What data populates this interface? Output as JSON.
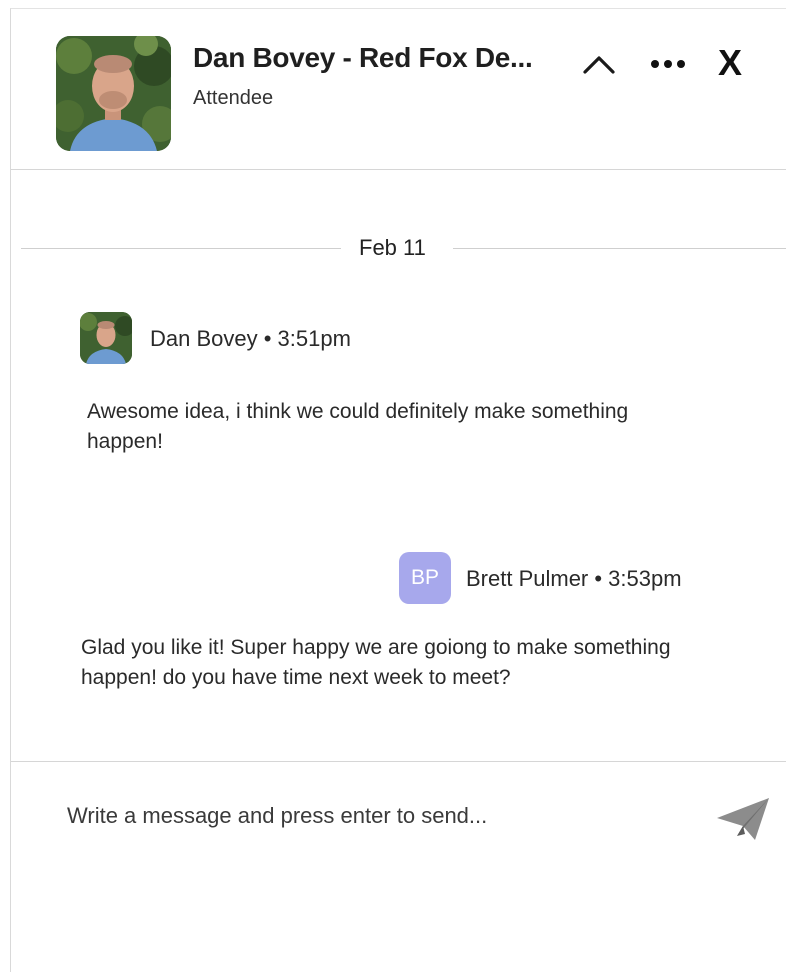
{
  "header": {
    "name": "Dan Bovey - Red Fox De...",
    "role": "Attendee",
    "collapse_icon": "chevron-up-icon",
    "more_icon": "more-horizontal-icon",
    "close_label": "X"
  },
  "conversation": {
    "date_divider": "Feb 11",
    "messages": [
      {
        "sender_meta": "Dan Bovey • 3:51pm",
        "avatar": "photo",
        "text": "Awesome idea, i think we could definitely make something happen!"
      },
      {
        "sender_meta": "Brett Pulmer • 3:53pm",
        "avatar_initials": "BP",
        "text": "Glad you like it! Super happy we are goiong to make something happen! do you have time next week to meet?"
      }
    ]
  },
  "composer": {
    "placeholder": "Write a message and press enter to send...",
    "value": "",
    "send_icon": "paper-plane-icon"
  },
  "colors": {
    "initials_avatar_bg": "#a7a8ec",
    "divider": "#d6d6d6"
  }
}
